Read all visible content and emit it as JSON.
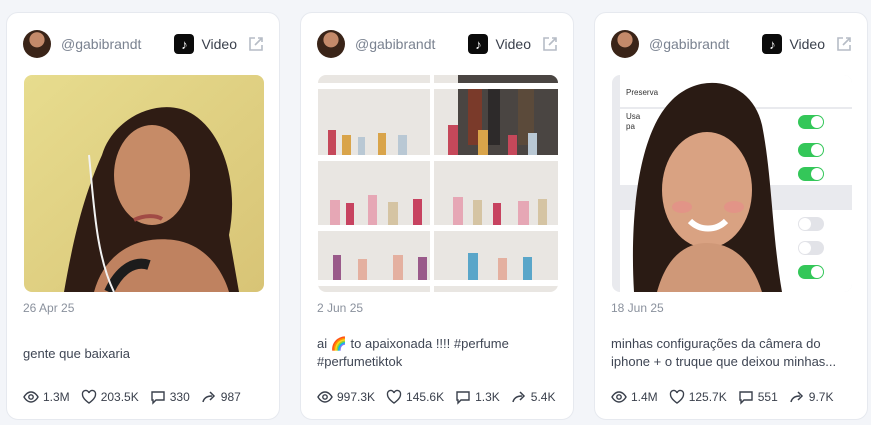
{
  "posts": [
    {
      "handle": "@gabibrandt",
      "platform": "Video",
      "date": "26 Apr 25",
      "caption": "gente que baixaria",
      "views": "1.3M",
      "likes": "203.5K",
      "comments": "330",
      "shares": "987"
    },
    {
      "handle": "@gabibrandt",
      "platform": "Video",
      "date": "2 Jun 25",
      "caption": "ai 🌈 to apaixonada !!!! #perfume #perfumetiktok",
      "views": "997.3K",
      "likes": "145.6K",
      "comments": "1.3K",
      "shares": "5.4K"
    },
    {
      "handle": "@gabibrandt",
      "platform": "Video",
      "date": "18 Jun 25",
      "caption": "minhas configurações da câmera do iphone + o truque que deixou minhas...",
      "views": "1.4M",
      "likes": "125.7K",
      "comments": "551",
      "shares": "9.7K"
    }
  ],
  "icons": {
    "platform": "tiktok-icon",
    "external": "external-link-icon",
    "views": "eye-icon",
    "likes": "heart-icon",
    "comments": "comment-icon",
    "shares": "share-icon"
  },
  "colors": {
    "card_bg": "#ffffff",
    "page_bg": "#f3f5f9",
    "muted": "#8a919d",
    "toggle_green": "#34c759"
  }
}
